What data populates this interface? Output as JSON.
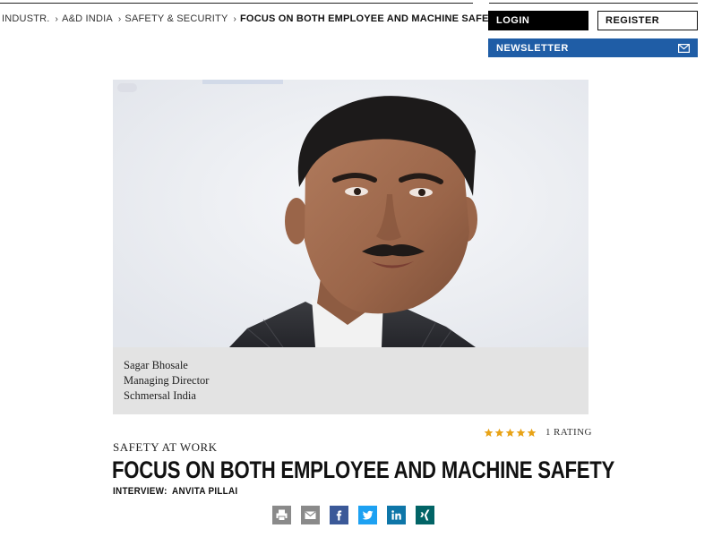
{
  "breadcrumb": [
    {
      "label": "INDUSTR."
    },
    {
      "label": "A&D INDIA"
    },
    {
      "label": "SAFETY & SECURITY"
    },
    {
      "label": "FOCUS ON BOTH EMPLOYEE AND MACHINE SAFETY"
    }
  ],
  "account": {
    "login_label": "LOGIN",
    "register_label": "REGISTER"
  },
  "newsletter": {
    "label": "NEWSLETTER",
    "icon": "mail-icon"
  },
  "caption": {
    "name": "Sagar Bhosale",
    "role": "Managing Director",
    "company": "Schmersal India"
  },
  "rating": {
    "stars_filled": 5,
    "stars_total": 5,
    "label": "1 RATING",
    "star_color": "#e8a317"
  },
  "article": {
    "kicker": "SAFETY AT WORK",
    "headline": "FOCUS ON BOTH EMPLOYEE AND MACHINE SAFETY",
    "byline_prefix": "INTERVIEW:",
    "byline_author": "ANVITA PILLAI"
  },
  "share": [
    {
      "name": "print",
      "icon": "print-icon",
      "color": "#8a8a8a"
    },
    {
      "name": "email",
      "icon": "envelope-icon",
      "color": "#8a8a8a"
    },
    {
      "name": "facebook",
      "icon": "facebook-icon",
      "color": "#3b5998"
    },
    {
      "name": "twitter",
      "icon": "twitter-icon",
      "color": "#1da1f2"
    },
    {
      "name": "linkedin",
      "icon": "linkedin-icon",
      "color": "#0e76a8"
    },
    {
      "name": "xing",
      "icon": "xing-icon",
      "color": "#026466"
    }
  ],
  "colors": {
    "newsletter_bg": "#1f5da6",
    "caption_bg": "#e3e3e3"
  }
}
